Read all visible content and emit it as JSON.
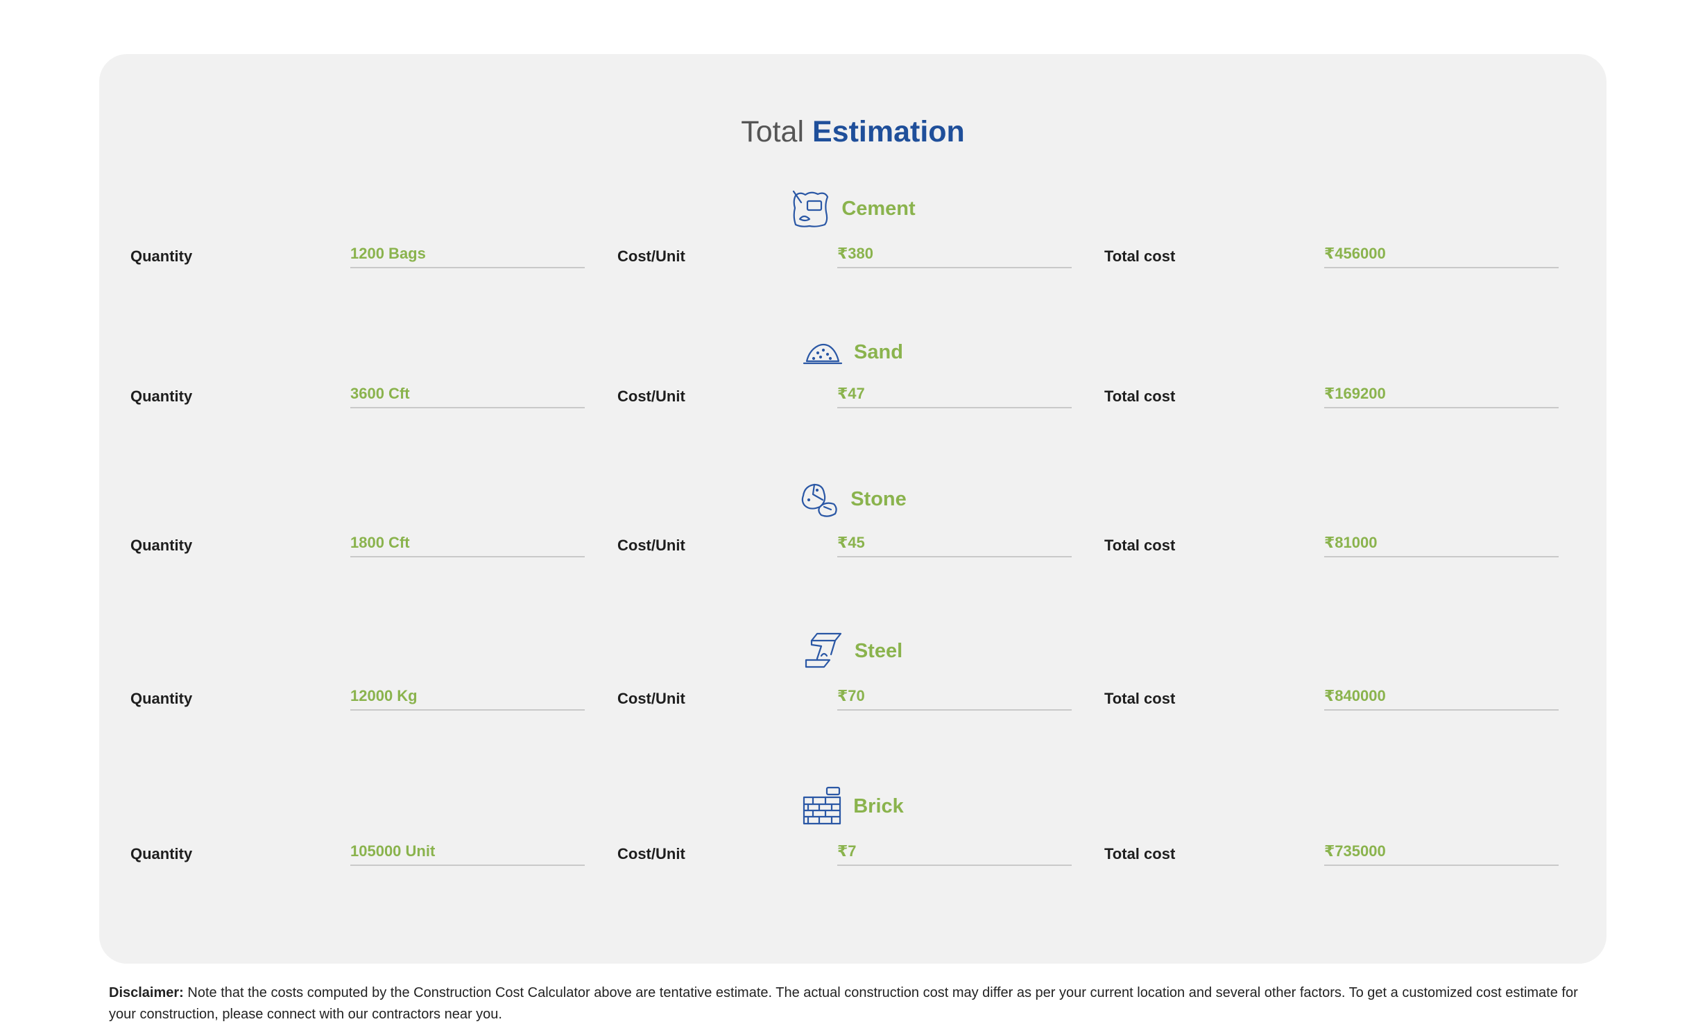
{
  "title": {
    "prefix": "Total",
    "highlight": "Estimation"
  },
  "labels": {
    "quantity": "Quantity",
    "cost_per_unit": "Cost/Unit",
    "total_cost": "Total cost"
  },
  "materials": [
    {
      "name": "Cement",
      "icon": "cement-bag-icon",
      "quantity": "1200 Bags",
      "cost_per_unit": "₹380",
      "total_cost": "₹456000"
    },
    {
      "name": "Sand",
      "icon": "sand-pile-icon",
      "quantity": "3600 Cft",
      "cost_per_unit": "₹47",
      "total_cost": "₹169200"
    },
    {
      "name": "Stone",
      "icon": "stone-icon",
      "quantity": "1800 Cft",
      "cost_per_unit": "₹45",
      "total_cost": "₹81000"
    },
    {
      "name": "Steel",
      "icon": "steel-beam-icon",
      "quantity": "12000 Kg",
      "cost_per_unit": "₹70",
      "total_cost": "₹840000"
    },
    {
      "name": "Brick",
      "icon": "brick-wall-icon",
      "quantity": "105000 Unit",
      "cost_per_unit": "₹7",
      "total_cost": "₹735000"
    }
  ],
  "disclaimer": {
    "label": "Disclaimer:",
    "text": "Note that the costs computed by the Construction Cost Calculator above are tentative estimate. The actual construction cost may differ as per your current location and several other factors. To get a customized cost estimate for your construction, please connect with our contractors near you."
  },
  "colors": {
    "accent_green": "#8ab34d",
    "brand_blue": "#1f4f9a",
    "card_bg": "#f1f1f1",
    "icon_blue": "#2a57a5"
  }
}
